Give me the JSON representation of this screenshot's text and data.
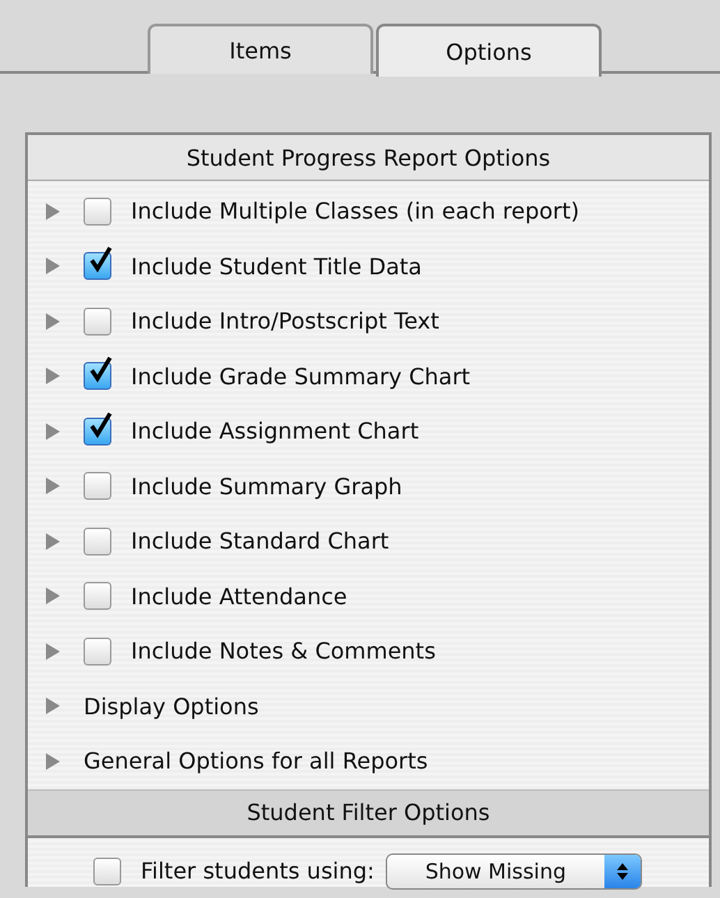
{
  "tabs": [
    {
      "label": "Items",
      "selected": false
    },
    {
      "label": "Options",
      "selected": true
    }
  ],
  "report_section": {
    "title": "Student Progress Report Options",
    "rows": [
      {
        "kind": "checkbox",
        "label": "Include Multiple Classes (in each report)",
        "checked": false
      },
      {
        "kind": "checkbox",
        "label": "Include Student Title Data",
        "checked": true
      },
      {
        "kind": "checkbox",
        "label": "Include Intro/Postscript Text",
        "checked": false
      },
      {
        "kind": "checkbox",
        "label": "Include Grade Summary Chart",
        "checked": true
      },
      {
        "kind": "checkbox",
        "label": "Include Assignment Chart",
        "checked": true
      },
      {
        "kind": "checkbox",
        "label": "Include Summary Graph",
        "checked": false
      },
      {
        "kind": "checkbox",
        "label": "Include Standard Chart",
        "checked": false
      },
      {
        "kind": "checkbox",
        "label": "Include Attendance",
        "checked": false
      },
      {
        "kind": "checkbox",
        "label": "Include Notes & Comments",
        "checked": false
      },
      {
        "kind": "group",
        "label": "Display Options"
      },
      {
        "kind": "group",
        "label": "General Options for all Reports"
      }
    ]
  },
  "filter_section": {
    "title": "Student Filter Options",
    "checked": false,
    "label": "Filter students using:",
    "popup_value": "Show Missing"
  }
}
